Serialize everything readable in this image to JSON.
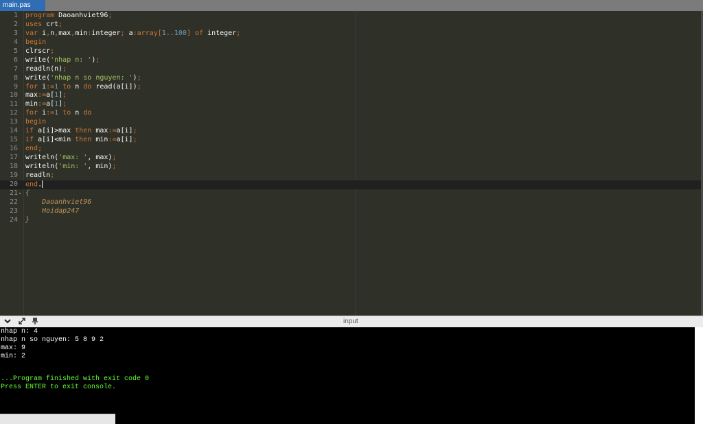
{
  "tab": {
    "label": "main.pas"
  },
  "editor": {
    "lines": [
      {
        "n": "1",
        "tokens": [
          [
            "kw",
            "program"
          ],
          [
            "id",
            " Daoanhviet96"
          ],
          [
            "op",
            ";"
          ]
        ]
      },
      {
        "n": "2",
        "tokens": [
          [
            "kw",
            "uses"
          ],
          [
            "id",
            " crt"
          ],
          [
            "op",
            ";"
          ]
        ]
      },
      {
        "n": "3",
        "tokens": [
          [
            "kw",
            "var"
          ],
          [
            "id",
            " i"
          ],
          [
            "op",
            ","
          ],
          [
            "id",
            "n"
          ],
          [
            "op",
            ","
          ],
          [
            "id",
            "max"
          ],
          [
            "op",
            ","
          ],
          [
            "id",
            "min"
          ],
          [
            "op",
            ":"
          ],
          [
            "id",
            "integer"
          ],
          [
            "op",
            ";"
          ],
          [
            "id",
            " a"
          ],
          [
            "op",
            ":"
          ],
          [
            "kw",
            "array"
          ],
          [
            "op",
            "["
          ],
          [
            "num",
            "1"
          ],
          [
            "op",
            ".."
          ],
          [
            "num",
            "100"
          ],
          [
            "op",
            "]"
          ],
          [
            "kw",
            " of"
          ],
          [
            "id",
            " integer"
          ],
          [
            "op",
            ";"
          ]
        ]
      },
      {
        "n": "4",
        "tokens": [
          [
            "kw",
            "begin"
          ]
        ]
      },
      {
        "n": "5",
        "tokens": [
          [
            "id",
            "clrscr"
          ],
          [
            "op",
            ";"
          ]
        ]
      },
      {
        "n": "6",
        "tokens": [
          [
            "id",
            "write("
          ],
          [
            "str",
            "'nhap n: '"
          ],
          [
            "id",
            ")"
          ],
          [
            "op",
            ";"
          ]
        ]
      },
      {
        "n": "7",
        "tokens": [
          [
            "id",
            "readln(n)"
          ],
          [
            "op",
            ";"
          ]
        ]
      },
      {
        "n": "8",
        "tokens": [
          [
            "id",
            "write("
          ],
          [
            "str",
            "'nhap n so nguyen: '"
          ],
          [
            "id",
            ")"
          ],
          [
            "op",
            ";"
          ]
        ]
      },
      {
        "n": "9",
        "tokens": [
          [
            "kw",
            "for"
          ],
          [
            "id",
            " i"
          ],
          [
            "op",
            ":="
          ],
          [
            "num",
            "1"
          ],
          [
            "kw",
            " to"
          ],
          [
            "id",
            " n"
          ],
          [
            "kw",
            " do"
          ],
          [
            "id",
            " read(a[i])"
          ],
          [
            "op",
            ";"
          ]
        ]
      },
      {
        "n": "10",
        "tokens": [
          [
            "id",
            "max"
          ],
          [
            "op",
            ":="
          ],
          [
            "id",
            "a["
          ],
          [
            "num",
            "1"
          ],
          [
            "id",
            "]"
          ],
          [
            "op",
            ";"
          ]
        ]
      },
      {
        "n": "11",
        "tokens": [
          [
            "id",
            "min"
          ],
          [
            "op",
            ":="
          ],
          [
            "id",
            "a["
          ],
          [
            "num",
            "1"
          ],
          [
            "id",
            "]"
          ],
          [
            "op",
            ";"
          ]
        ]
      },
      {
        "n": "12",
        "tokens": [
          [
            "kw",
            "for"
          ],
          [
            "id",
            " i"
          ],
          [
            "op",
            ":="
          ],
          [
            "num",
            "1"
          ],
          [
            "kw",
            " to"
          ],
          [
            "id",
            " n"
          ],
          [
            "kw",
            " do"
          ]
        ]
      },
      {
        "n": "13",
        "tokens": [
          [
            "kw",
            "begin"
          ]
        ]
      },
      {
        "n": "14",
        "tokens": [
          [
            "kw",
            "if"
          ],
          [
            "id",
            " a[i]>max"
          ],
          [
            "kw",
            " then"
          ],
          [
            "id",
            " max"
          ],
          [
            "op",
            ":="
          ],
          [
            "id",
            "a[i]"
          ],
          [
            "op",
            ";"
          ]
        ]
      },
      {
        "n": "15",
        "tokens": [
          [
            "kw",
            "if"
          ],
          [
            "id",
            " a[i]<min"
          ],
          [
            "kw",
            " then"
          ],
          [
            "id",
            " min"
          ],
          [
            "op",
            ":="
          ],
          [
            "id",
            "a[i]"
          ],
          [
            "op",
            ";"
          ]
        ]
      },
      {
        "n": "16",
        "tokens": [
          [
            "kw",
            "end"
          ],
          [
            "op",
            ";"
          ]
        ]
      },
      {
        "n": "17",
        "tokens": [
          [
            "id",
            "writeln("
          ],
          [
            "str",
            "'max: '"
          ],
          [
            "id",
            ", max)"
          ],
          [
            "op",
            ";"
          ]
        ]
      },
      {
        "n": "18",
        "tokens": [
          [
            "id",
            "writeln("
          ],
          [
            "str",
            "'min: '"
          ],
          [
            "id",
            ", min)"
          ],
          [
            "op",
            ";"
          ]
        ]
      },
      {
        "n": "19",
        "tokens": [
          [
            "id",
            "readln"
          ],
          [
            "op",
            ";"
          ]
        ]
      },
      {
        "n": "20",
        "tokens": [
          [
            "kw",
            "end"
          ],
          [
            "id",
            "."
          ]
        ],
        "active": true,
        "cursor": true
      },
      {
        "n": "21",
        "tokens": [
          [
            "cm",
            "{"
          ]
        ],
        "fold": true
      },
      {
        "n": "22",
        "tokens": [
          [
            "cm",
            "    Daoanhviet96"
          ]
        ]
      },
      {
        "n": "23",
        "tokens": [
          [
            "cm",
            "    Hoidap247"
          ]
        ]
      },
      {
        "n": "24",
        "tokens": [
          [
            "cm",
            "}"
          ]
        ]
      }
    ]
  },
  "console_bar": {
    "label": "input",
    "icons": [
      "chevron-down-icon",
      "expand-icon",
      "pin-icon"
    ]
  },
  "console": {
    "output": [
      "nhap n: 4",
      "nhap n so nguyen: 5 8 9 2",
      "max: 9",
      "min: 2"
    ],
    "finish": [
      "...Program finished with exit code 0",
      "Press ENTER to exit console."
    ]
  },
  "colors": {
    "editor_bg": "#2f3129",
    "keyword": "#cc7833",
    "string": "#a5c261",
    "number": "#6d9cbe",
    "comment": "#bc9458",
    "console_finish": "#66ff33",
    "tab_active": "#2f6db5"
  }
}
